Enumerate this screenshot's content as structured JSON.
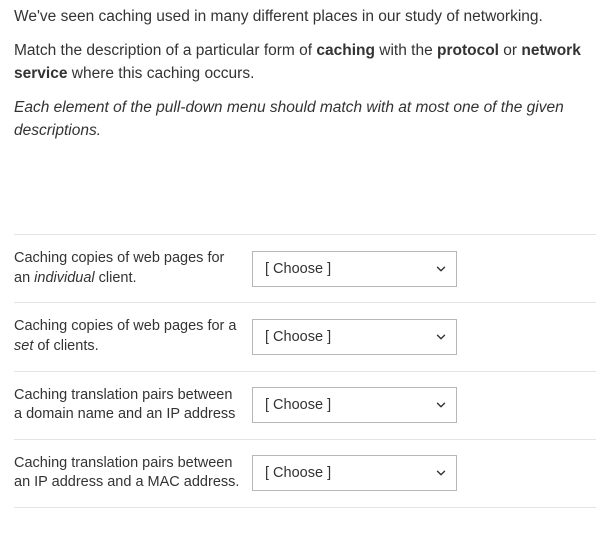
{
  "intro": {
    "p1_a": "We've seen caching used in many different places in our study of networking.",
    "p2_a": "Match the description of a particular form of ",
    "p2_b": "caching",
    "p2_c": " with the ",
    "p2_d": "protocol",
    "p2_e": " or ",
    "p2_f": "network service",
    "p2_g": " where this caching occurs.",
    "p3_a": "Each element of the pull-down menu should match with at most one of the given descriptions."
  },
  "rows": [
    {
      "a": "Caching copies of web pages for an ",
      "it": "individual",
      "b": " client.",
      "select": "[ Choose ]"
    },
    {
      "a": "Caching copies of web pages for a ",
      "it": "set",
      "b": " of clients.",
      "select": "[ Choose ]"
    },
    {
      "a": "Caching translation pairs between a domain name and an IP address",
      "it": "",
      "b": "",
      "select": "[ Choose ]"
    },
    {
      "a": "Caching translation pairs between an IP address and a MAC address.",
      "it": "",
      "b": "",
      "select": "[ Choose ]"
    }
  ]
}
